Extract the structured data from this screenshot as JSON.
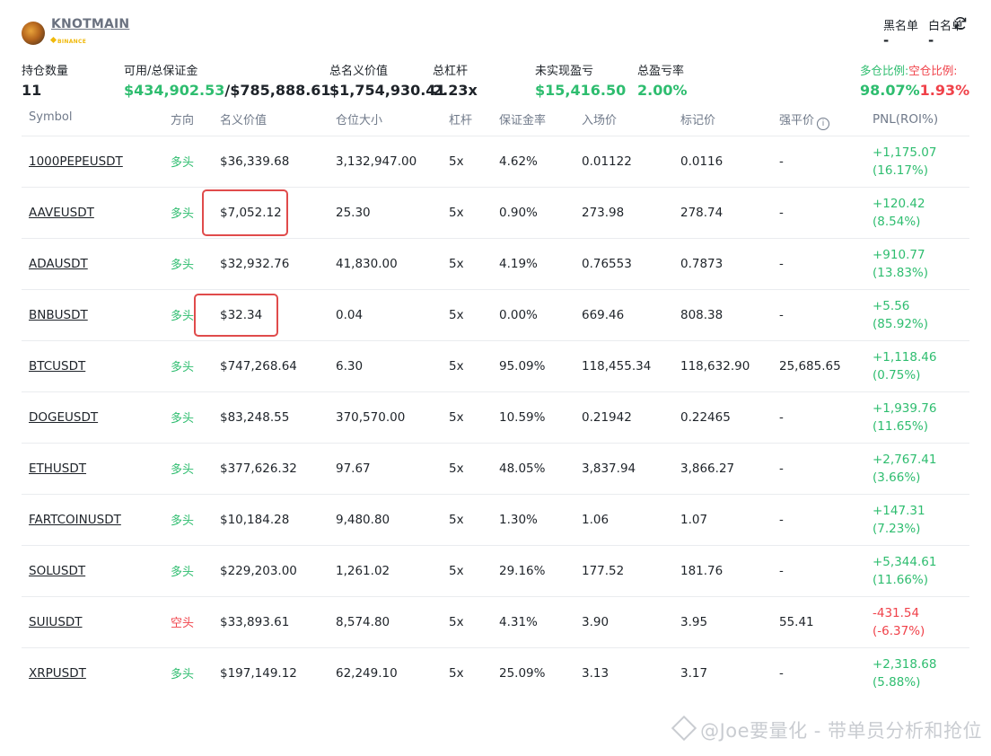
{
  "header": {
    "trader_name": "KNOTMAIN",
    "exchange_badge": "BINANCE",
    "blacklist_label": "黑名单",
    "whitelist_label": "白名单",
    "blacklist_count": "-",
    "whitelist_count": "-"
  },
  "summary": {
    "positions_label": "持仓数量",
    "positions_value": "11",
    "margin_label": "可用/总保证金",
    "available_margin": "$434,902.53",
    "total_margin": "/$785,888.61",
    "notional_label": "总名义价值",
    "notional_value": "$1,754,930.41",
    "leverage_label": "总杠杆",
    "leverage_value": "2.23x",
    "upnl_label": "未实现盈亏",
    "upnl_value": "$15,416.50",
    "pnl_rate_label": "总盈亏率",
    "pnl_rate_value": "2.00%",
    "long_ratio_label": "多仓比例:",
    "short_ratio_label": "空仓比例:",
    "long_ratio_value": "98.07%",
    "short_ratio_value": "1.93%"
  },
  "table": {
    "headers": {
      "symbol": "Symbol",
      "direction": "方向",
      "notional": "名义价值",
      "size": "仓位大小",
      "leverage": "杠杆",
      "margin_rate": "保证金率",
      "entry_price": "入场价",
      "mark_price": "标记价",
      "liq_price": "强平价",
      "pnl": "PNL(ROI%)"
    },
    "rows": [
      {
        "symbol": "1000PEPEUSDT",
        "direction": "多头",
        "notional": "$36,339.68",
        "size": "3,132,947.00",
        "leverage": "5x",
        "margin_rate": "4.62%",
        "entry": "0.01122",
        "mark": "0.0116",
        "liq": "-",
        "pnl": "+1,175.07",
        "roi": "(16.17%)"
      },
      {
        "symbol": "AAVEUSDT",
        "direction": "多头",
        "notional": "$7,052.12",
        "size": "25.30",
        "leverage": "5x",
        "margin_rate": "0.90%",
        "entry": "273.98",
        "mark": "278.74",
        "liq": "-",
        "pnl": "+120.42",
        "roi": "(8.54%)"
      },
      {
        "symbol": "ADAUSDT",
        "direction": "多头",
        "notional": "$32,932.76",
        "size": "41,830.00",
        "leverage": "5x",
        "margin_rate": "4.19%",
        "entry": "0.76553",
        "mark": "0.7873",
        "liq": "-",
        "pnl": "+910.77",
        "roi": "(13.83%)"
      },
      {
        "symbol": "BNBUSDT",
        "direction": "多头",
        "notional": "$32.34",
        "size": "0.04",
        "leverage": "5x",
        "margin_rate": "0.00%",
        "entry": "669.46",
        "mark": "808.38",
        "liq": "-",
        "pnl": "+5.56",
        "roi": "(85.92%)"
      },
      {
        "symbol": "BTCUSDT",
        "direction": "多头",
        "notional": "$747,268.64",
        "size": "6.30",
        "leverage": "5x",
        "margin_rate": "95.09%",
        "entry": "118,455.34",
        "mark": "118,632.90",
        "liq": "25,685.65",
        "pnl": "+1,118.46",
        "roi": "(0.75%)"
      },
      {
        "symbol": "DOGEUSDT",
        "direction": "多头",
        "notional": "$83,248.55",
        "size": "370,570.00",
        "leverage": "5x",
        "margin_rate": "10.59%",
        "entry": "0.21942",
        "mark": "0.22465",
        "liq": "-",
        "pnl": "+1,939.76",
        "roi": "(11.65%)"
      },
      {
        "symbol": "ETHUSDT",
        "direction": "多头",
        "notional": "$377,626.32",
        "size": "97.67",
        "leverage": "5x",
        "margin_rate": "48.05%",
        "entry": "3,837.94",
        "mark": "3,866.27",
        "liq": "-",
        "pnl": "+2,767.41",
        "roi": "(3.66%)"
      },
      {
        "symbol": "FARTCOINUSDT",
        "direction": "多头",
        "notional": "$10,184.28",
        "size": "9,480.80",
        "leverage": "5x",
        "margin_rate": "1.30%",
        "entry": "1.06",
        "mark": "1.07",
        "liq": "-",
        "pnl": "+147.31",
        "roi": "(7.23%)"
      },
      {
        "symbol": "SOLUSDT",
        "direction": "多头",
        "notional": "$229,203.00",
        "size": "1,261.02",
        "leverage": "5x",
        "margin_rate": "29.16%",
        "entry": "177.52",
        "mark": "181.76",
        "liq": "-",
        "pnl": "+5,344.61",
        "roi": "(11.66%)"
      },
      {
        "symbol": "SUIUSDT",
        "direction": "空头",
        "notional": "$33,893.61",
        "size": "8,574.80",
        "leverage": "5x",
        "margin_rate": "4.31%",
        "entry": "3.90",
        "mark": "3.95",
        "liq": "55.41",
        "pnl": "-431.54",
        "roi": "(-6.37%)"
      },
      {
        "symbol": "XRPUSDT",
        "direction": "多头",
        "notional": "$197,149.12",
        "size": "62,249.10",
        "leverage": "5x",
        "margin_rate": "25.09%",
        "entry": "3.13",
        "mark": "3.17",
        "liq": "-",
        "pnl": "+2,318.68",
        "roi": "(5.88%)"
      }
    ]
  },
  "watermark": "@Joe要量化 - 带单员分析和抢位",
  "colors": {
    "profit": "#2ebd6f",
    "loss": "#f0424a",
    "highlight": "#e04b4b"
  },
  "icons": {
    "refresh": "refresh-icon",
    "info": "info-icon",
    "avatar": "avatar"
  }
}
